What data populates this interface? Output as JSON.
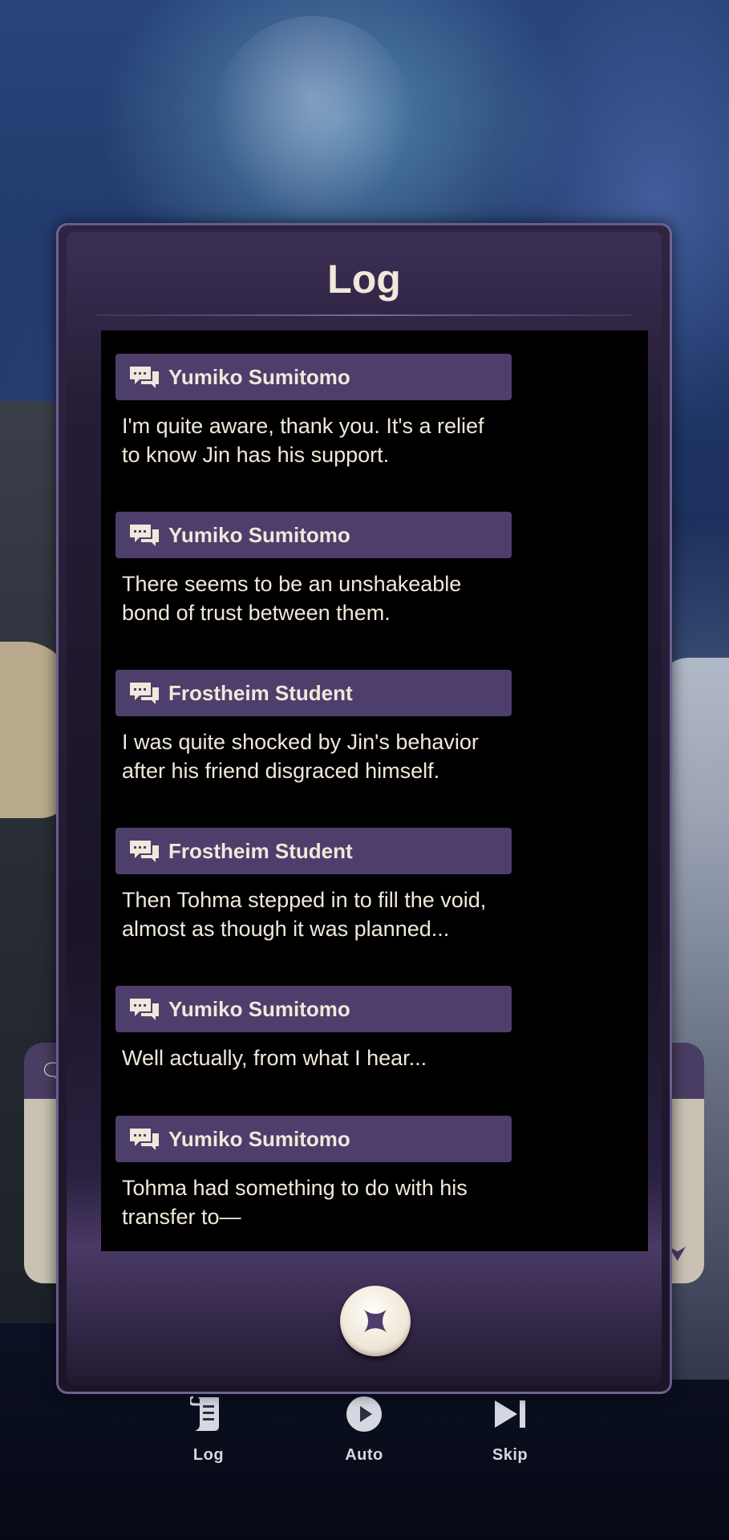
{
  "log": {
    "title": "Log",
    "close_icon": "close-x-icon",
    "entries": [
      {
        "speaker": "Yumiko Sumitomo",
        "text": "I'm quite aware, thank you. It's a relief\nto know Jin has his support."
      },
      {
        "speaker": "Yumiko Sumitomo",
        "text": "There seems to be an unshakeable\nbond of trust between them."
      },
      {
        "speaker": "Frostheim Student",
        "text": "I was quite shocked by Jin's behavior\nafter his friend disgraced himself."
      },
      {
        "speaker": "Frostheim Student",
        "text": "Then Tohma stepped in to fill the void,\nalmost as though it was planned..."
      },
      {
        "speaker": "Yumiko Sumitomo",
        "text": "Well actually, from what I hear..."
      },
      {
        "speaker": "Yumiko Sumitomo",
        "text": "Tohma had something to do with his\ntransfer to—"
      }
    ]
  },
  "controls": {
    "log_label": "Log",
    "auto_label": "Auto",
    "skip_label": "Skip"
  },
  "colors": {
    "speaker_bar": "#4e3e6c",
    "text": "#f1e8db",
    "panel": "#000000"
  }
}
